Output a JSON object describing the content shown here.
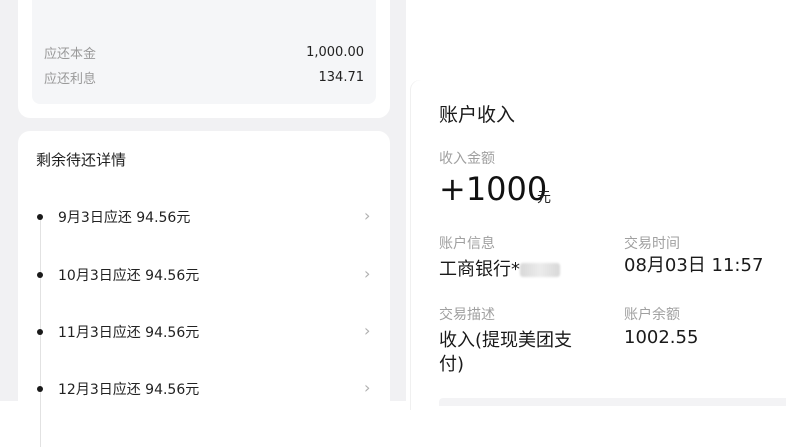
{
  "summary": {
    "principal_label": "应还本金",
    "principal_value": "1,000.00",
    "interest_label": "应还利息",
    "interest_value": "134.71"
  },
  "remaining": {
    "title": "剩余待还详情",
    "items": [
      {
        "label": "9月3日应还 94.56元"
      },
      {
        "label": "10月3日应还 94.56元"
      },
      {
        "label": "11月3日应还 94.56元"
      },
      {
        "label": "12月3日应还 94.56元"
      }
    ]
  },
  "income": {
    "title": "账户收入",
    "amount_label": "收入金额",
    "amount": "+1000",
    "amount_unit": "元",
    "account_info_label": "账户信息",
    "account_info_value": "工商银行*",
    "time_label": "交易时间",
    "time_value": "08月03日 11:57",
    "desc_label": "交易描述",
    "desc_value_line1": "收入(提现美团支",
    "desc_value_line2": "付)",
    "balance_label": "账户余额",
    "balance_value": "1002.55"
  },
  "icons": {
    "chevron": "›"
  }
}
